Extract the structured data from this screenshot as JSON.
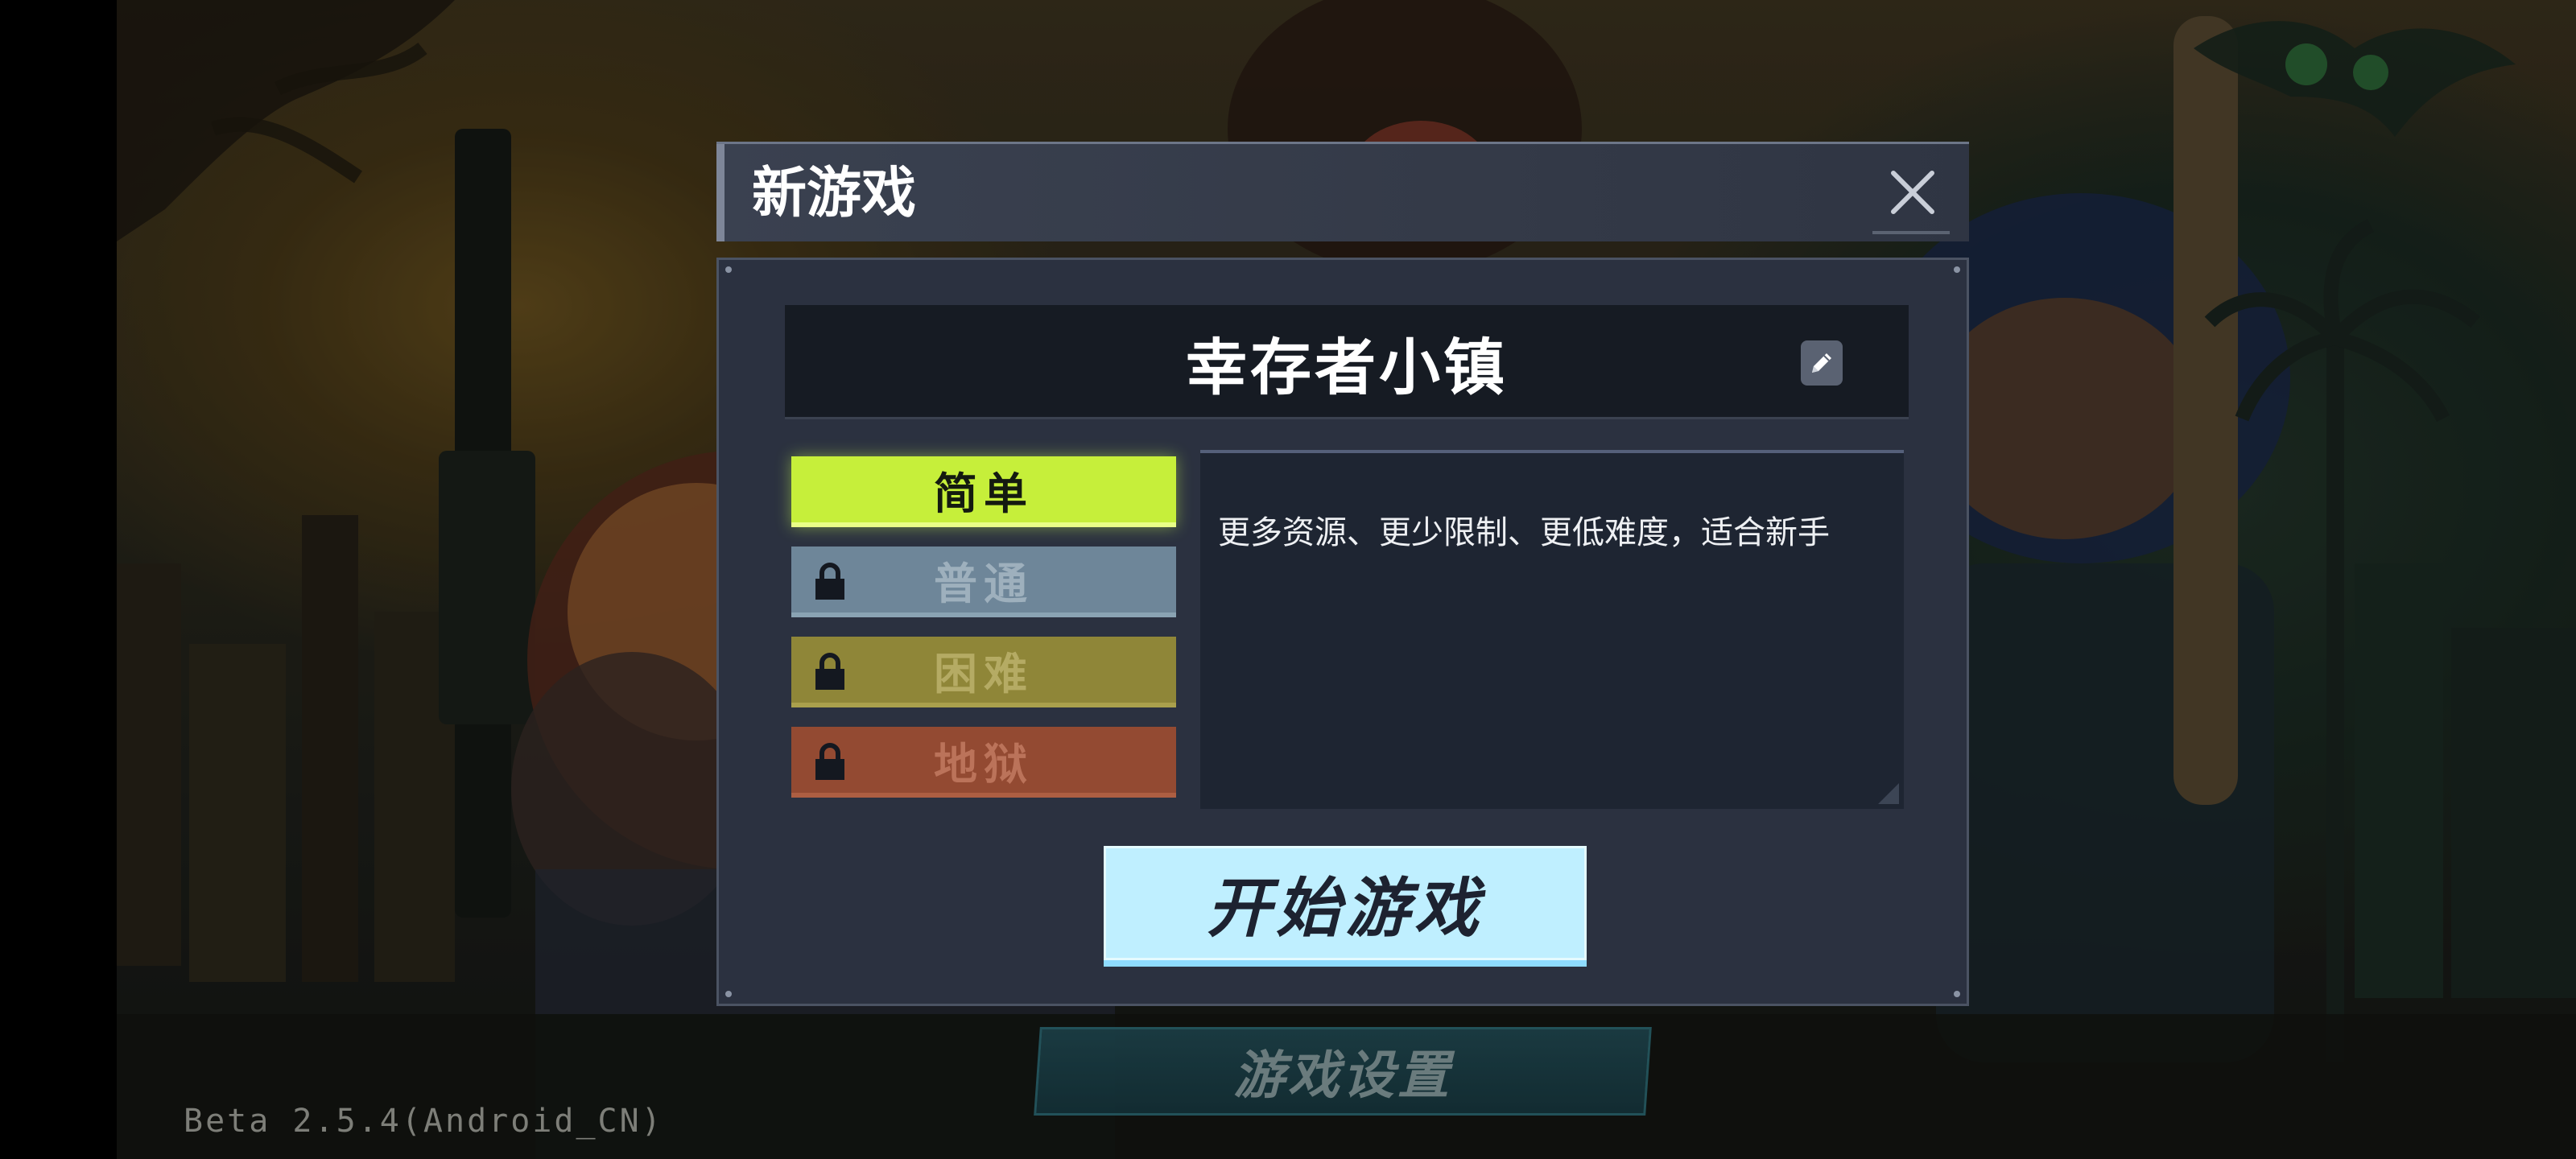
{
  "dialog": {
    "title": "新游戏",
    "close_icon": "close-icon"
  },
  "town": {
    "name": "幸存者小镇",
    "edit_icon": "pencil-icon"
  },
  "difficulties": [
    {
      "label": "简单",
      "locked": false,
      "selected": true,
      "color": "#c6ef3a"
    },
    {
      "label": "普通",
      "locked": true,
      "selected": false,
      "color": "#6e8699"
    },
    {
      "label": "困难",
      "locked": true,
      "selected": false,
      "color": "#8f8638"
    },
    {
      "label": "地狱",
      "locked": true,
      "selected": false,
      "color": "#934a32"
    }
  ],
  "description": "更多资源、更少限制、更低难度，适合新手",
  "start_button_label": "开始游戏",
  "background": {
    "settings_button_label": "游戏设置",
    "version": "Beta 2.5.4(Android_CN)"
  }
}
